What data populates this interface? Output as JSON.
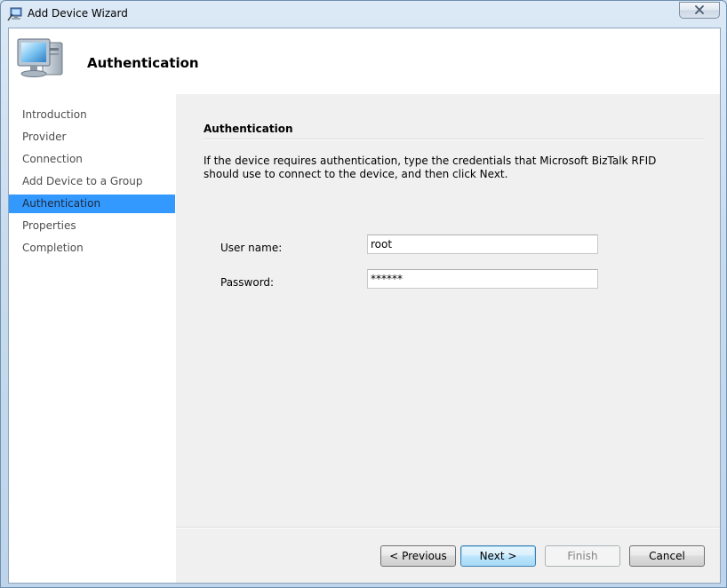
{
  "window": {
    "title": "Add Device Wizard"
  },
  "header": {
    "title": "Authentication",
    "icon": "computer-icon"
  },
  "nav": {
    "items": [
      {
        "label": "Introduction"
      },
      {
        "label": "Provider"
      },
      {
        "label": "Connection"
      },
      {
        "label": "Add Device to a Group"
      },
      {
        "label": "Authentication",
        "active": true
      },
      {
        "label": "Properties"
      },
      {
        "label": "Completion"
      }
    ]
  },
  "section": {
    "title": "Authentication",
    "description": "If the device requires authentication, type the credentials that Microsoft BizTalk RFID should use to connect to the device, and then click Next."
  },
  "form": {
    "username_label": "User name:",
    "username_value": "root",
    "password_label": "Password:",
    "password_value": "******"
  },
  "buttons": {
    "previous": "< Previous",
    "next": "Next >",
    "finish": "Finish",
    "cancel": "Cancel"
  },
  "colors": {
    "selection": "#3399ff",
    "content_bg": "#f0f0f0"
  }
}
